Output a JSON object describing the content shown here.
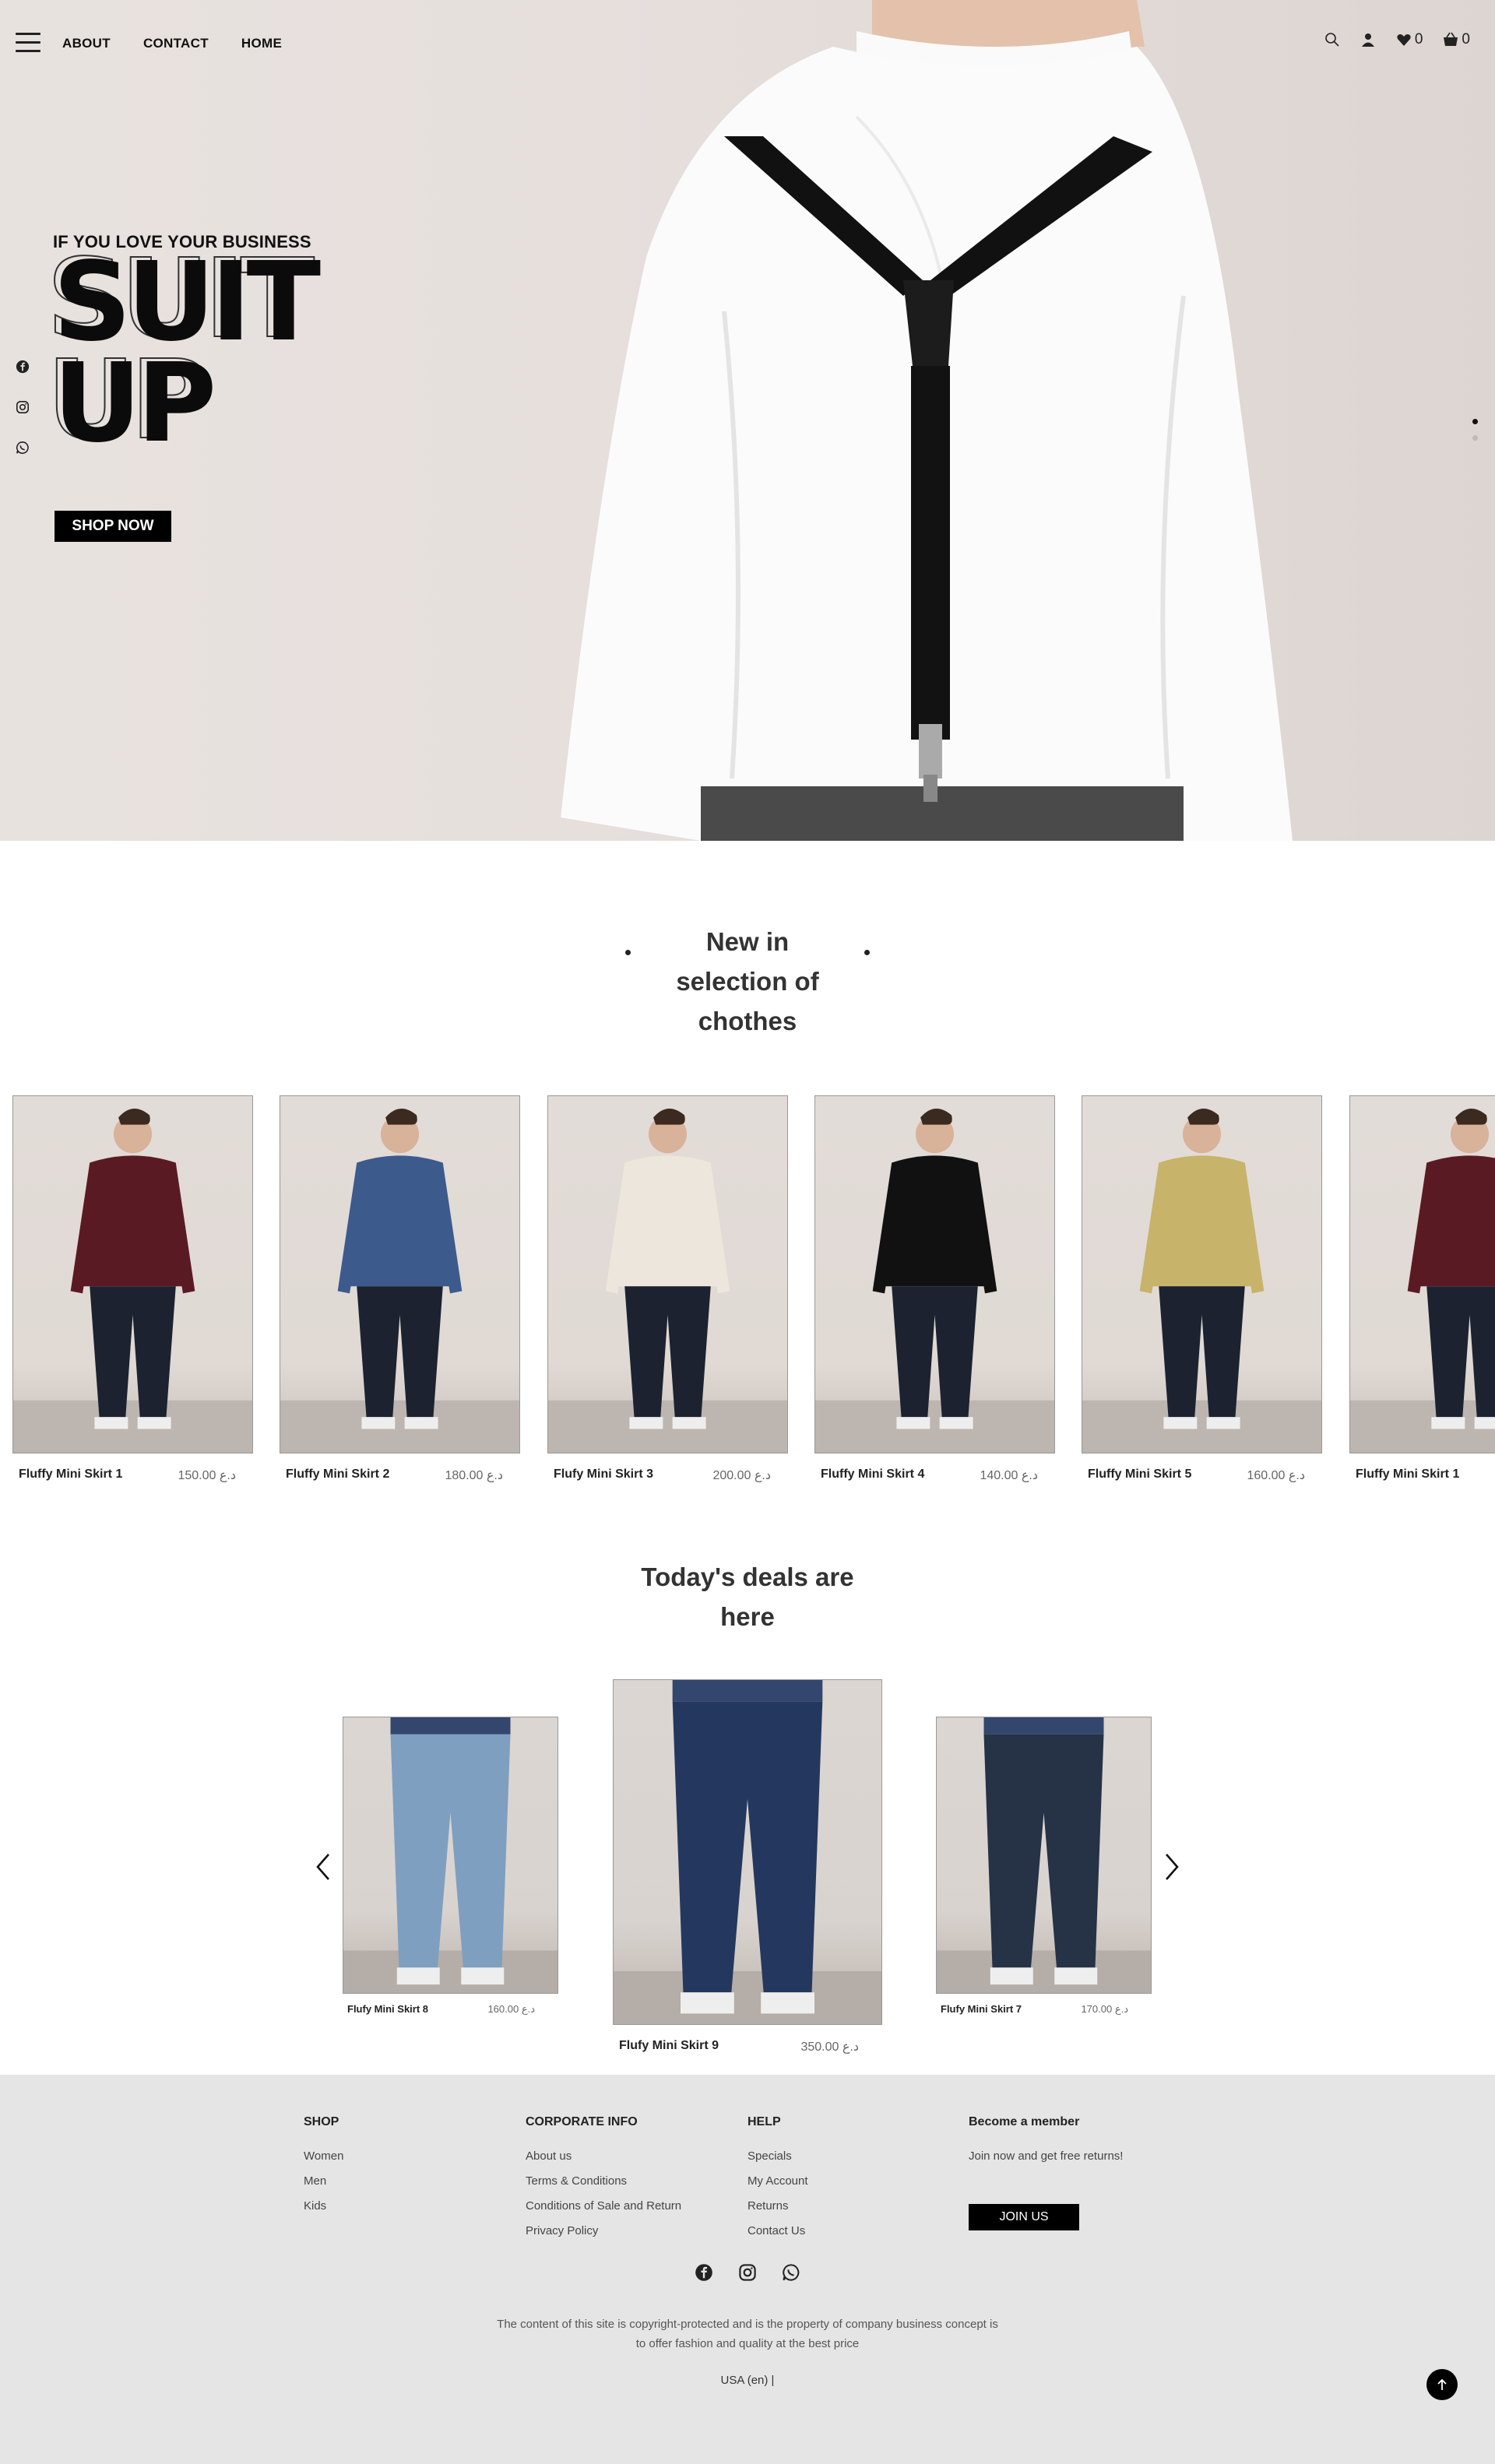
{
  "nav": {
    "links": [
      "ABOUT",
      "CONTACT",
      "HOME"
    ],
    "wishlist_count": "0",
    "cart_count": "0"
  },
  "hero": {
    "tagline": "IF YOU LOVE YOUR BUSINESS",
    "line1": "SUIT",
    "line2": "UP",
    "cta": "SHOP NOW"
  },
  "new_in": {
    "title_lines": [
      "New in",
      "selection of",
      "chothes"
    ],
    "products": [
      {
        "name": "Fluffy Mini Skirt 1",
        "price": "150.00 د.ع",
        "color": "#5a1a24"
      },
      {
        "name": "Fluffy Mini Skirt 2",
        "price": "180.00 د.ع",
        "color": "#3d5a8c"
      },
      {
        "name": "Flufy Mini Skirt 3",
        "price": "200.00 د.ع",
        "color": "#ece6dc"
      },
      {
        "name": "Fluffy Mini Skirt 4",
        "price": "140.00 د.ع",
        "color": "#111111"
      },
      {
        "name": "Fluffy Mini Skirt 5",
        "price": "160.00 د.ع",
        "color": "#c8b36a"
      },
      {
        "name": "Fluffy Mini Skirt 1",
        "price": "",
        "color": "#5a1a24"
      }
    ]
  },
  "deals": {
    "title_lines": [
      "Today's deals are",
      "here"
    ],
    "items": [
      {
        "name": "Flufy Mini Skirt 8",
        "price": "160.00 د.ع",
        "color": "#7f9fc0"
      },
      {
        "name": "Flufy Mini Skirt 9",
        "price": "350.00 د.ع",
        "color": "#24385f"
      },
      {
        "name": "Flufy Mini Skirt 7",
        "price": "170.00 د.ع",
        "color": "#263246"
      }
    ]
  },
  "footer": {
    "shop": {
      "heading": "SHOP",
      "links": [
        "Women",
        "Men",
        "Kids"
      ]
    },
    "corporate": {
      "heading": "CORPORATE INFO",
      "links": [
        "About us",
        "Terms & Conditions",
        "Conditions of Sale and Return",
        "Privacy Policy"
      ]
    },
    "help": {
      "heading": "HELP",
      "links": [
        "Specials",
        "My Account",
        "Returns",
        "Contact Us"
      ]
    },
    "member": {
      "heading": "Become a member",
      "text": "Join now and get free returns!",
      "button": "JOIN US"
    },
    "copyright_lines": [
      "The content of this site is copyright-protected and is the property of company business concept is",
      "to offer fashion and quality at the best price"
    ],
    "locale": "USA (en)  |"
  }
}
